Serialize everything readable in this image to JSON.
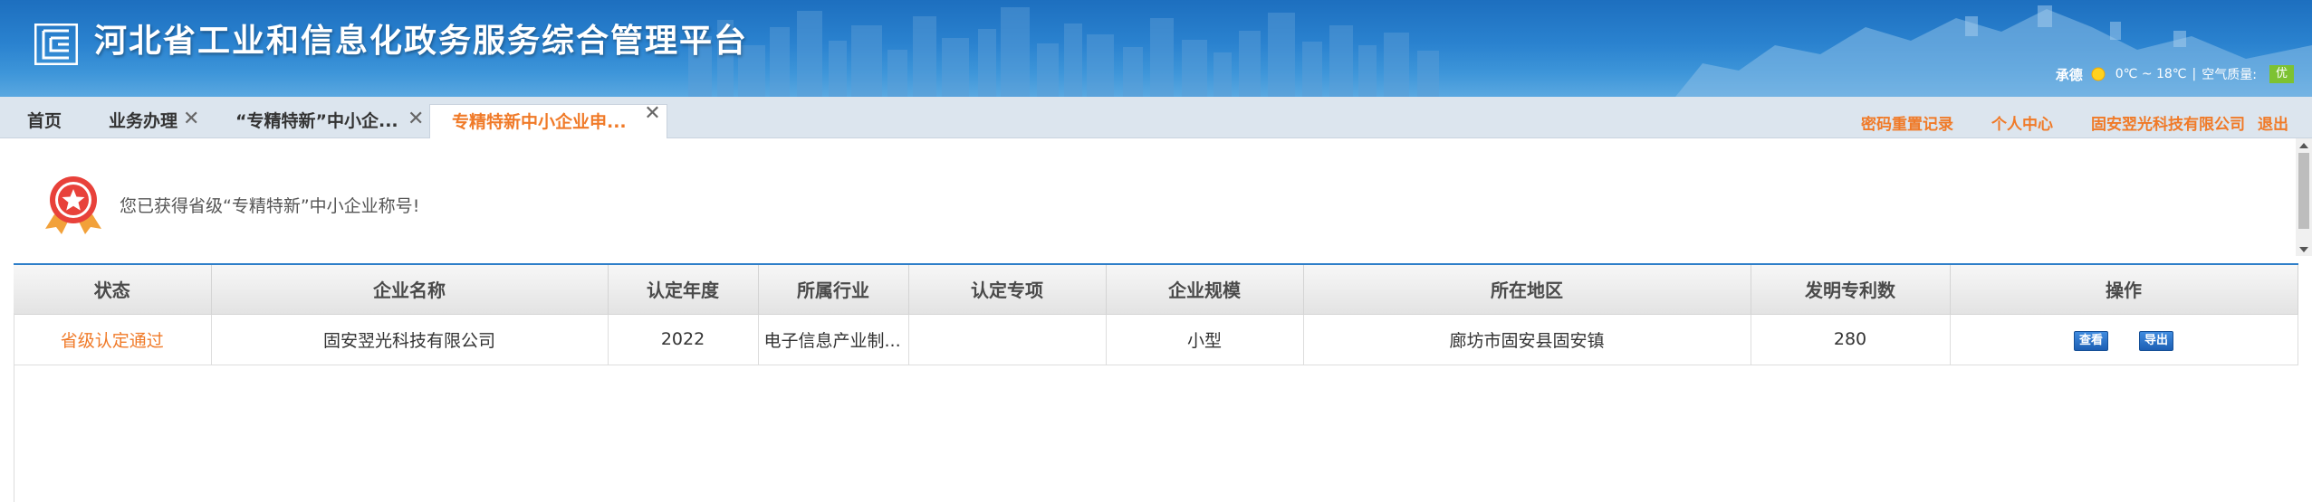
{
  "header": {
    "title": "河北省工业和信息化政务服务综合管理平台",
    "weather": {
      "city": "承德",
      "temp": "0℃ ~ 18℃",
      "separator": "|",
      "aq_label": "空气质量:",
      "aq_value": "优",
      "icon": "sun-icon"
    }
  },
  "tabs": [
    {
      "label": "首页"
    },
    {
      "label": "业务办理"
    },
    {
      "label": "“专精特新”中小企..."
    },
    {
      "label": "专精特新中小企业申..."
    }
  ],
  "top_links": {
    "reset_record": "密码重置记录",
    "personal_center": "个人中心",
    "company": "固安翌光科技有限公司",
    "logout": "退出"
  },
  "notice": {
    "text": "您已获得省级“专精特新”中小企业称号!",
    "icon": "medal-icon"
  },
  "table": {
    "columns": [
      "状态",
      "企业名称",
      "认定年度",
      "所属行业",
      "认定专项",
      "企业规模",
      "所在地区",
      "发明专利数",
      "操作"
    ],
    "rows": [
      {
        "status": "省级认定通过",
        "company": "固安翌光科技有限公司",
        "year": "2022",
        "industry": "电子信息产业制...",
        "special": "",
        "scale": "小型",
        "region": "廊坊市固安县固安镇",
        "patents": "280",
        "view_label": "查看",
        "export_label": "导出"
      }
    ]
  },
  "colors": {
    "accent": "#f07a28",
    "header_blue": "#2a82cf",
    "table_rule": "#2f7fc9",
    "aq_green": "#7dc232"
  }
}
